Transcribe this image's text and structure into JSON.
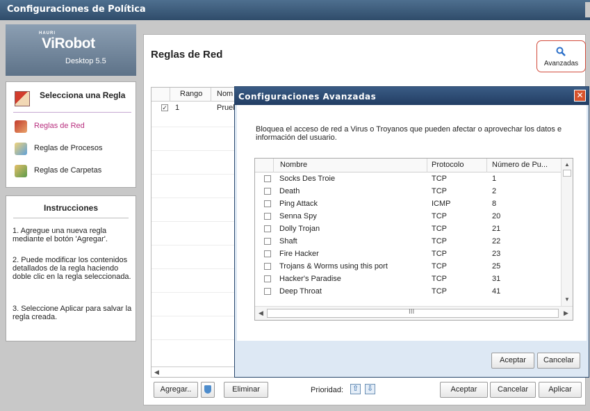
{
  "window": {
    "title": "Configuraciones de Política"
  },
  "logo": {
    "brand": "HAURI",
    "name": "ViRobot",
    "version": "Desktop 5.5"
  },
  "sidebar": {
    "heading": "Selecciona una Regla",
    "items": [
      {
        "label": "Reglas de Red",
        "icon": "network-rules-icon",
        "active": true
      },
      {
        "label": "Reglas de Procesos",
        "icon": "process-rules-icon",
        "active": false
      },
      {
        "label": "Reglas de Carpetas",
        "icon": "folder-rules-icon",
        "active": false
      }
    ]
  },
  "instructions": {
    "title": "Instrucciones",
    "steps": [
      "1. Agregue una nueva regla mediante el botón 'Agregar'.",
      "2. Puede modificar los contenidos detallados de la regla haciendo doble clic en la regla seleccionada.",
      "3. Seleccione Aplicar para salvar la regla creada."
    ]
  },
  "main": {
    "title": "Reglas de Red",
    "advanced_button": "Avanzadas",
    "columns": [
      "Rango",
      "Nom"
    ],
    "rows": [
      {
        "checked": true,
        "rango": "1",
        "nombre": "Prueb"
      }
    ]
  },
  "toolbar": {
    "add": "Agregar..",
    "delete": "Eliminar",
    "priority_label": "Prioridad:",
    "accept": "Aceptar",
    "cancel": "Cancelar",
    "apply": "Aplicar"
  },
  "dialog": {
    "title": "Configuraciones Avanzadas",
    "description": "Bloquea el acceso de red a Virus o Troyanos que pueden afectar o aprovechar los datos e información del usuario.",
    "columns": [
      "Nombre",
      "Protocolo",
      "Número de Pu..."
    ],
    "rows": [
      {
        "name": "Socks Des Troie",
        "protocol": "TCP",
        "port": "1"
      },
      {
        "name": "Death",
        "protocol": "TCP",
        "port": "2"
      },
      {
        "name": "Ping Attack",
        "protocol": "ICMP",
        "port": "8"
      },
      {
        "name": "Senna Spy",
        "protocol": "TCP",
        "port": "20"
      },
      {
        "name": "Dolly Trojan",
        "protocol": "TCP",
        "port": "21"
      },
      {
        "name": "Shaft",
        "protocol": "TCP",
        "port": "22"
      },
      {
        "name": "Fire Hacker",
        "protocol": "TCP",
        "port": "23"
      },
      {
        "name": "Trojans & Worms using this port",
        "protocol": "TCP",
        "port": "25"
      },
      {
        "name": "Hacker's Paradise",
        "protocol": "TCP",
        "port": "31"
      },
      {
        "name": "Deep Throat",
        "protocol": "TCP",
        "port": "41"
      }
    ],
    "scroll_grip": "III",
    "accept": "Aceptar",
    "cancel": "Cancelar"
  },
  "colors": {
    "accent": "#b82e7e",
    "title_bar": "#2f4c6a",
    "dialog_bg": "#dde8f4",
    "close": "#d9532c"
  }
}
